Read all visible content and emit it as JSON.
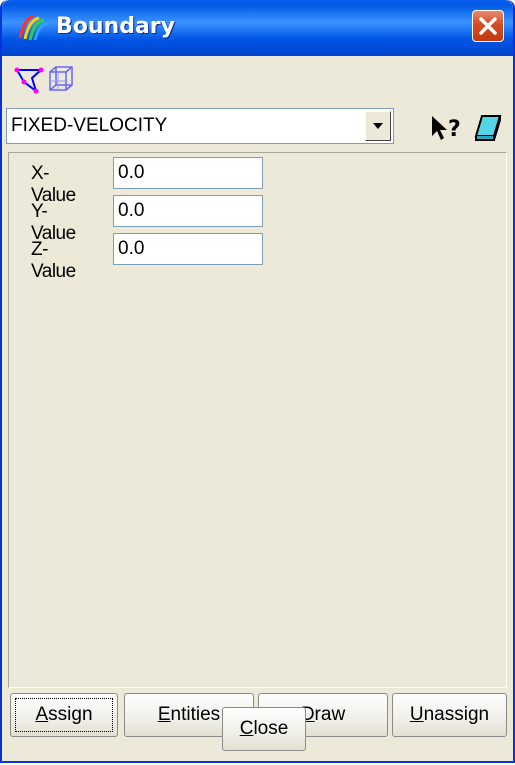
{
  "window": {
    "title": "Boundary",
    "close_label": "Close window"
  },
  "toolbar": {
    "icons": [
      "surface-select-icon",
      "volume-select-icon"
    ]
  },
  "condition": {
    "selected": "FIXED-VELOCITY"
  },
  "fields": [
    {
      "label": "X-Value",
      "value": "0.0"
    },
    {
      "label": "Y-Value",
      "value": "0.0"
    },
    {
      "label": "Z-Value",
      "value": "0.0"
    }
  ],
  "actions": {
    "assign": {
      "mnemonic": "A",
      "rest": "ssign"
    },
    "entities": {
      "mnemonic": "E",
      "rest": "ntities"
    },
    "draw": {
      "mnemonic": "D",
      "rest": "raw"
    },
    "unassign": {
      "mnemonic": "U",
      "rest": "nassign"
    }
  },
  "footer": {
    "close": {
      "mnemonic": "C",
      "rest": "lose"
    }
  },
  "colors": {
    "titlebar": "#0058e6",
    "dialog_bg": "#ece9d8",
    "close_button": "#d54b24"
  }
}
